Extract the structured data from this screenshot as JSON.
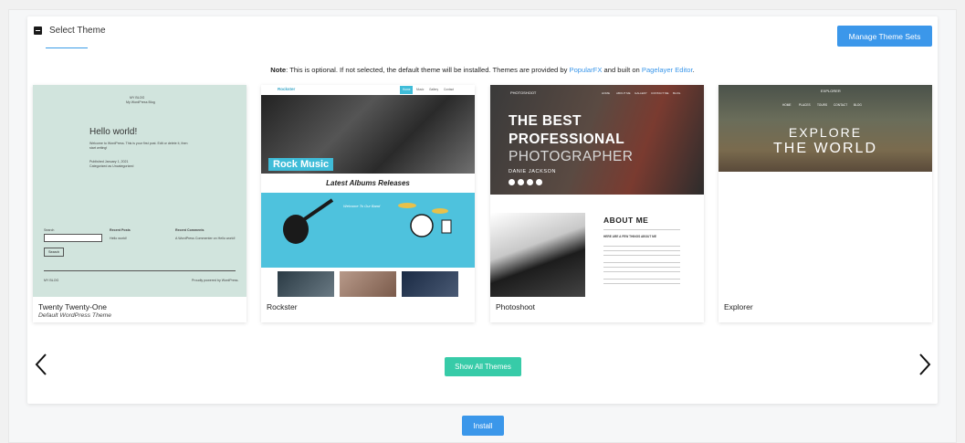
{
  "section": {
    "title": "Select Theme",
    "manage_button": "Manage Theme Sets"
  },
  "note": {
    "label": "Note",
    "text_before": ": This is optional. If not selected, the default theme will be installed. Themes are provided by ",
    "link1": "PopularFX",
    "text_mid": " and built on ",
    "link2": "Pagelayer Editor",
    "text_after": "."
  },
  "themes": [
    {
      "name": "Twenty Twenty-One",
      "subtitle": "Default WordPress Theme",
      "preview": {
        "blog_title": "MY BLOG",
        "blog_tagline": "My WordPress Blog",
        "hello": "Hello world!",
        "welcome_text": "Welcome to WordPress. This is your first post. Edit or delete it, then start writing!",
        "published": "Published January 1, 2021",
        "categorized": "Categorized as Uncategorized",
        "search_label": "Search",
        "search_button": "Search",
        "recent_posts": "Recent Posts",
        "recent_post_item": "Hello world!",
        "recent_comments": "Recent Comments",
        "recent_comment_item": "A WordPress Commenter on Hello world!",
        "footer_left": "MY BLOG",
        "footer_right": "Proudly powered by WordPress."
      }
    },
    {
      "name": "Rockster",
      "subtitle": "",
      "preview": {
        "logo": "Rockster",
        "nav": [
          "Home",
          "Music",
          "Gallery",
          "Contact"
        ],
        "hero_label": "Rock Music",
        "section_title": "Latest Albums Releases",
        "welcome": "Welcome To Our Band"
      }
    },
    {
      "name": "Photoshoot",
      "subtitle": "",
      "preview": {
        "logo": "PHOTOSHOOT",
        "nav": [
          "HOME",
          "ABOUT ME",
          "GALLERY",
          "CONTACT ME",
          "BLOG"
        ],
        "headline1": "THE BEST",
        "headline2": "PROFESSIONAL",
        "headline3": "PHOTOGRAPHER",
        "name": "DANIE JACKSON",
        "about_title": "ABOUT ME",
        "about_sub": "HERE ARE A FEW THINGS ABOUT ME"
      }
    },
    {
      "name": "Explorer",
      "subtitle": "",
      "preview": {
        "brand": "EXPLORER",
        "nav": [
          "HOME",
          "PLACES",
          "TOURS",
          "CONTACT",
          "BLOG"
        ],
        "headline1": "EXPLORE",
        "headline2": "THE WORLD"
      }
    }
  ],
  "actions": {
    "show_all": "Show All Themes",
    "install": "Install"
  },
  "colors": {
    "primary": "#3b97ea",
    "show_all": "#37cba8",
    "t1_bg": "#d1e4dd",
    "rockster_blue": "#4ec2dd"
  },
  "icons": {
    "collapse": "minus-square-icon",
    "prev": "chevron-left-icon",
    "next": "chevron-right-icon"
  }
}
